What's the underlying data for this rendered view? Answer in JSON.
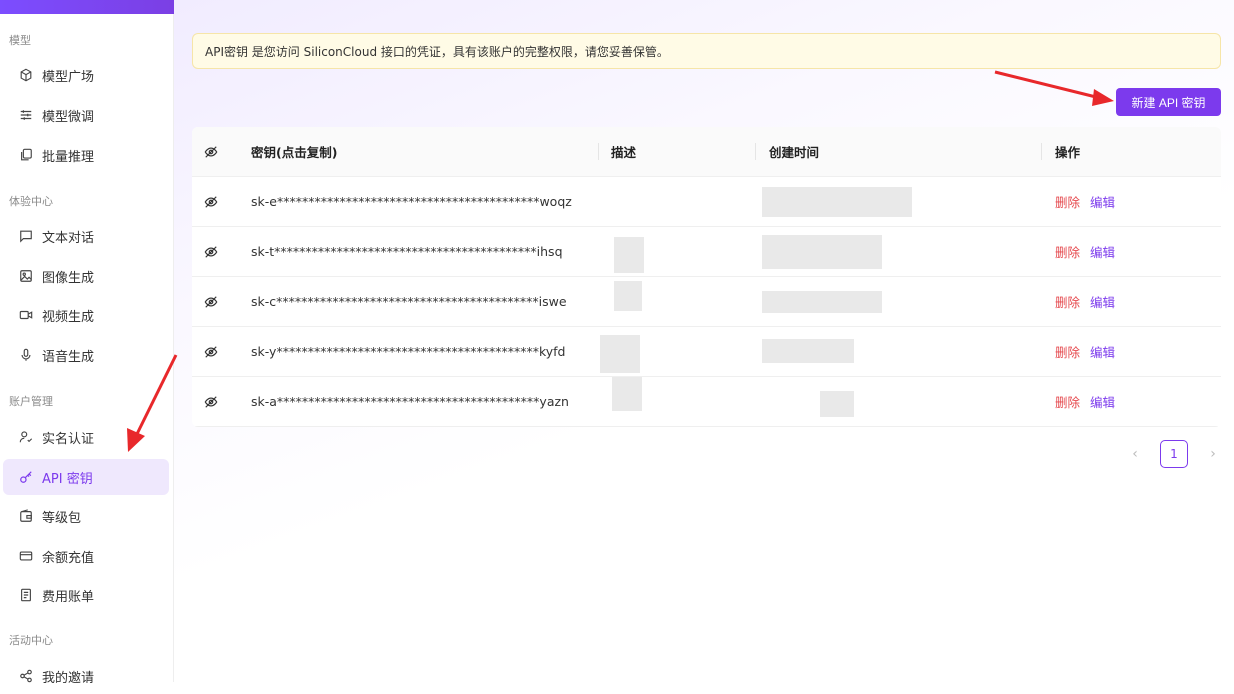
{
  "sidebar": {
    "groups": [
      {
        "label": "模型",
        "items": [
          {
            "label": "模型广场",
            "icon": "cube-icon"
          },
          {
            "label": "模型微调",
            "icon": "sliders-icon"
          },
          {
            "label": "批量推理",
            "icon": "copy-icon"
          }
        ]
      },
      {
        "label": "体验中心",
        "items": [
          {
            "label": "文本对话",
            "icon": "chat-icon"
          },
          {
            "label": "图像生成",
            "icon": "image-icon"
          },
          {
            "label": "视频生成",
            "icon": "video-icon"
          },
          {
            "label": "语音生成",
            "icon": "mic-icon"
          }
        ]
      },
      {
        "label": "账户管理",
        "items": [
          {
            "label": "实名认证",
            "icon": "user-check-icon"
          },
          {
            "label": "API 密钥",
            "icon": "key-icon",
            "active": true
          },
          {
            "label": "等级包",
            "icon": "wallet-icon"
          },
          {
            "label": "余额充值",
            "icon": "card-icon"
          },
          {
            "label": "费用账单",
            "icon": "receipt-icon"
          }
        ]
      },
      {
        "label": "活动中心",
        "items": [
          {
            "label": "我的邀请",
            "icon": "share-icon"
          }
        ]
      }
    ]
  },
  "notice": "API密钥 是您访问 SiliconCloud 接口的凭证，具有该账户的完整权限，请您妥善保管。",
  "new_button": "新建 API 密钥",
  "table": {
    "headers": {
      "key": "密钥(点击复制)",
      "desc": "描述",
      "time": "创建时间",
      "ops": "操作"
    },
    "rows": [
      {
        "key": "sk-e******************************************woqz"
      },
      {
        "key": "sk-t******************************************ihsq"
      },
      {
        "key": "sk-c******************************************iswe"
      },
      {
        "key": "sk-y******************************************kyfd"
      },
      {
        "key": "sk-a******************************************yazn"
      }
    ],
    "delete_label": "删除",
    "edit_label": "编辑"
  },
  "pagination": {
    "current": "1"
  },
  "colors": {
    "accent": "#7c3aed",
    "danger": "#e5484d",
    "notice_bg": "#fffbe6"
  }
}
